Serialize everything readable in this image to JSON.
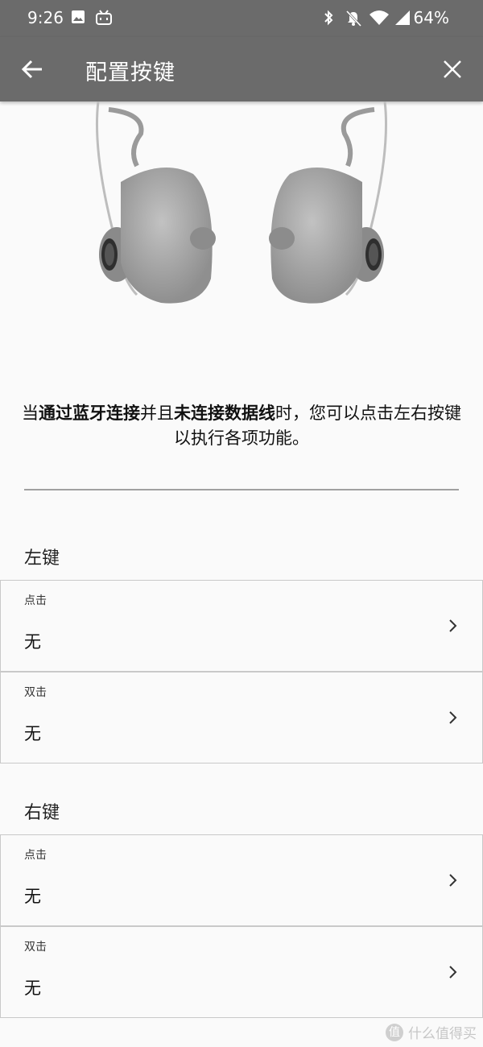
{
  "status_bar": {
    "time": "9:26",
    "battery": "64%",
    "icons": [
      "image-icon",
      "bilibili-icon",
      "bluetooth-icon",
      "do-not-disturb-icon",
      "wifi-icon",
      "cellular-icon"
    ]
  },
  "app_bar": {
    "title": "配置按键",
    "back_icon": "arrow-back-icon",
    "close_icon": "close-icon"
  },
  "intro": {
    "p1": "当",
    "b1": "通过蓝牙连接",
    "p2": "并且",
    "b2": "未连接数据线",
    "p3": "时，您可以点击左右按键以执行各项功能。"
  },
  "left_key": {
    "title": "左键",
    "single": {
      "label": "点击",
      "value": "无"
    },
    "double": {
      "label": "双击",
      "value": "无"
    }
  },
  "right_key": {
    "title": "右键",
    "single": {
      "label": "点击",
      "value": "无"
    },
    "double": {
      "label": "双击",
      "value": "无"
    }
  },
  "watermark": {
    "badge": "值",
    "text": "什么值得买"
  },
  "colors": {
    "bar": "#6b6b6b",
    "background": "#fafafa",
    "earbud": "#9a9a9a"
  }
}
